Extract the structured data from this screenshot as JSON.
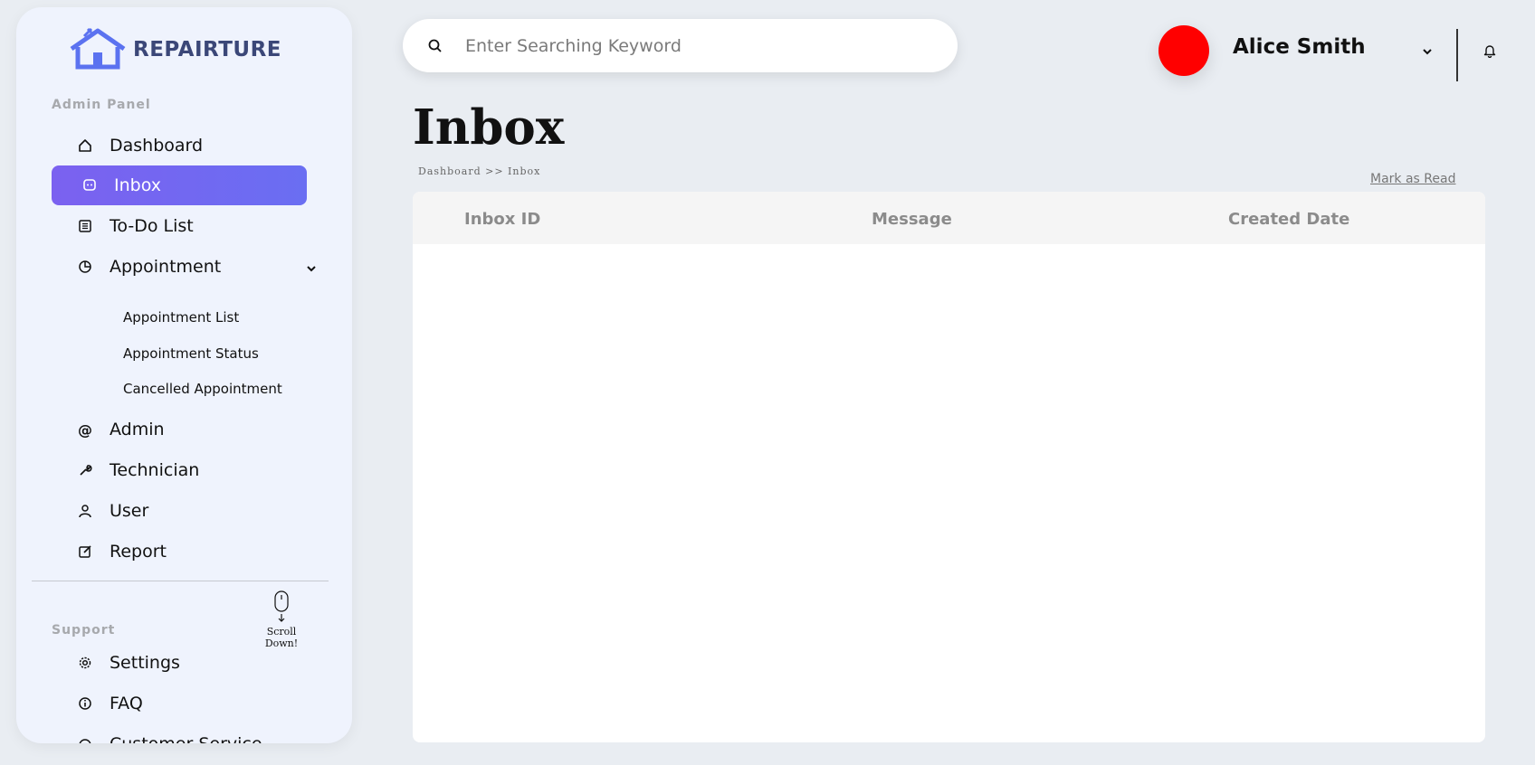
{
  "brand": {
    "name": "REPAIRTURE",
    "color": "#5b72f0"
  },
  "sidebar": {
    "admin_label": "Admin Panel",
    "items": [
      {
        "label": "Dashboard",
        "icon": "home-icon"
      },
      {
        "label": "Inbox",
        "icon": "chat-icon",
        "active": true
      },
      {
        "label": "To-Do List",
        "icon": "list-icon"
      },
      {
        "label": "Appointment",
        "icon": "pie-chart-icon",
        "expanded": true
      }
    ],
    "appointment_sub": [
      "Appointment List",
      "Appointment Status",
      "Cancelled Appointment"
    ],
    "items2": [
      {
        "label": "Admin",
        "icon": "at-icon"
      },
      {
        "label": "Technician",
        "icon": "wrench-icon"
      },
      {
        "label": "User",
        "icon": "user-icon"
      },
      {
        "label": "Report",
        "icon": "edit-icon"
      }
    ],
    "support_label": "Support",
    "scroll_hint": "Scroll Down!",
    "support_items": [
      {
        "label": "Settings",
        "icon": "gear-icon"
      },
      {
        "label": "FAQ",
        "icon": "info-icon"
      },
      {
        "label": "Customer Service",
        "icon": "headset-icon"
      }
    ]
  },
  "search": {
    "placeholder": "Enter Searching Keyword",
    "value": ""
  },
  "user": {
    "name": "Alice Smith",
    "avatar_color": "#ff0000"
  },
  "page": {
    "title": "Inbox",
    "breadcrumb": "Dashboard >> Inbox",
    "mark_read": "Mark as Read"
  },
  "table": {
    "columns": [
      "Inbox ID",
      "Message",
      "Created Date"
    ],
    "rows": []
  },
  "colors": {
    "accent": "#7065f1",
    "background": "#e9edf2",
    "sidebar": "#eff3fd"
  }
}
